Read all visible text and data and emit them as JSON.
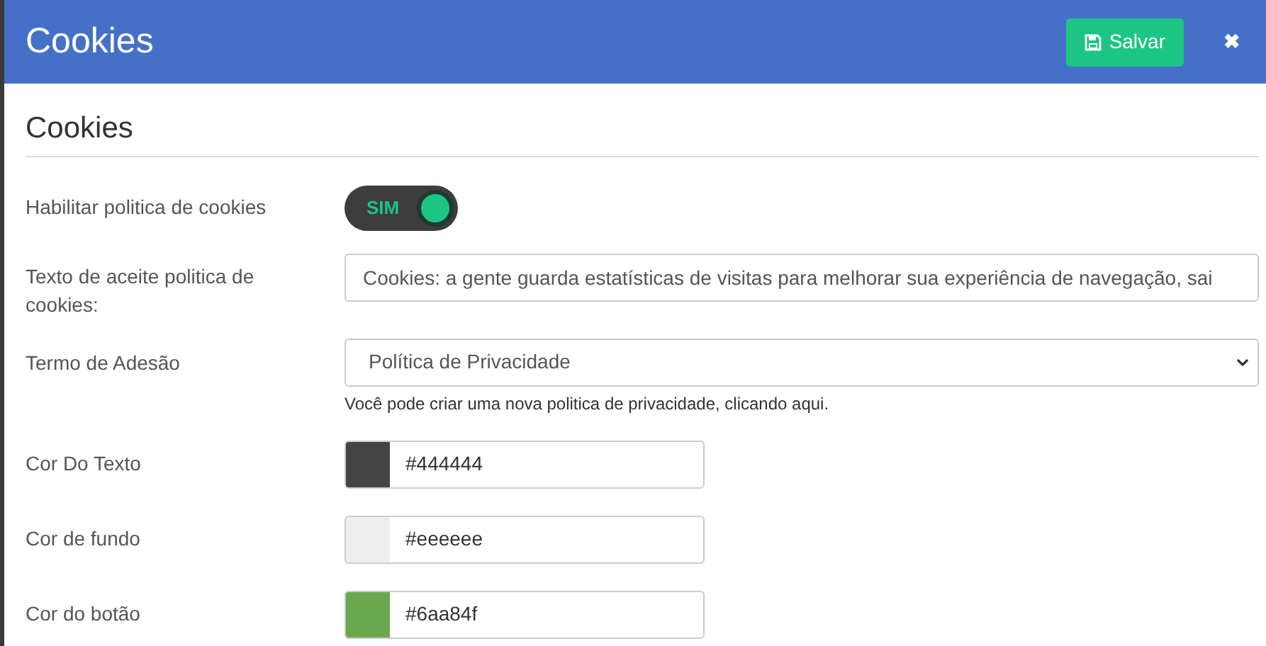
{
  "header": {
    "title": "Cookies",
    "save_button": "Salvar",
    "close": "✖"
  },
  "section_title": "Cookies",
  "enable_policy": {
    "label": "Habilitar politica de cookies",
    "on": true,
    "text": "SIM"
  },
  "acceptance_text": {
    "label": "Texto de aceite politica de cookies:",
    "value": "Cookies: a gente guarda estatísticas de visitas para melhorar sua experiência de navegação, sai"
  },
  "terms": {
    "label": "Termo de Adesão",
    "value": "Política de Privacidade",
    "help": "Você pode criar uma nova politica de privacidade, clicando aqui."
  },
  "colors": [
    {
      "label": "Cor Do Texto",
      "value": "#444444",
      "color": "#444444"
    },
    {
      "label": "Cor de fundo",
      "value": "#eeeeee",
      "color": "#eeeeee"
    },
    {
      "label": "Cor do botão",
      "value": "#6aa84f",
      "color": "#6aa84f"
    }
  ]
}
